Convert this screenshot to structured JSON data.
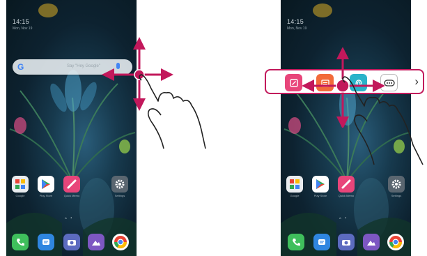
{
  "left_phone": {
    "time": "14:15",
    "date": "Mon, Nov 19",
    "search_placeholder": "Say \"Hey Google\"",
    "apps_row": [
      {
        "icon": "folder-icon",
        "label": "Google"
      },
      {
        "icon": "play-store-icon",
        "label": "Play Store"
      },
      {
        "icon": "pen-icon",
        "label": "Quick Memo"
      },
      {
        "icon": "gear-icon",
        "label": "Settings"
      }
    ],
    "dock": [
      {
        "icon": "phone-icon"
      },
      {
        "icon": "message-icon"
      },
      {
        "icon": "camera-icon"
      },
      {
        "icon": "gallery-icon"
      },
      {
        "icon": "chrome-icon"
      }
    ],
    "page_dots": "⌂ •"
  },
  "right_phone": {
    "time": "14:15",
    "date": "Mon, Nov 19",
    "quick_bar_apps": [
      {
        "icon": "memo-icon",
        "color": "#e8457a"
      },
      {
        "icon": "calendar-icon",
        "color": "#f26b3a"
      },
      {
        "icon": "fingerprint-icon",
        "color": "#2ab3c9"
      },
      {
        "icon": "more-icon",
        "color": "#ffffff"
      }
    ],
    "quick_bar_chevron": "›",
    "apps_row": [
      {
        "icon": "folder-icon",
        "label": "Google"
      },
      {
        "icon": "play-store-icon",
        "label": "Play Store"
      },
      {
        "icon": "pen-icon",
        "label": "Quick Memo"
      },
      {
        "icon": "gear-icon",
        "label": "Settings"
      }
    ],
    "page_dots": "⌂ •"
  },
  "colors": {
    "arrow": "#c2185b",
    "bar_border": "#c2185b"
  }
}
